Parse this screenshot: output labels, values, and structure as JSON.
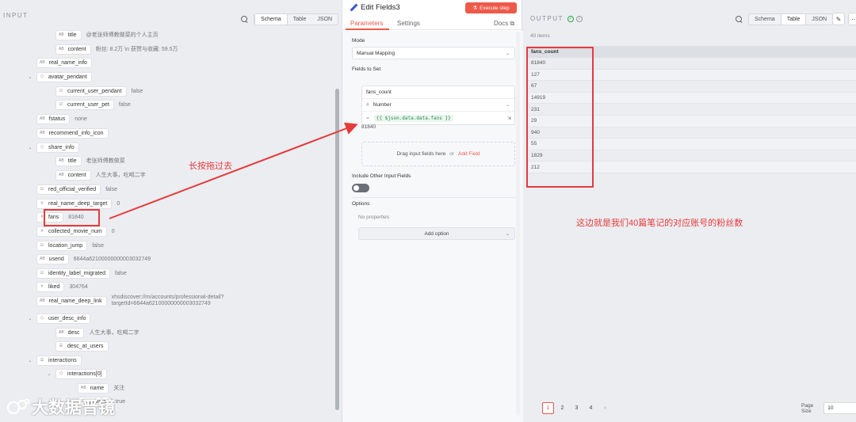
{
  "input_panel": {
    "title": "INPUT",
    "view_modes": [
      "Schema",
      "Table",
      "JSON"
    ],
    "tree": [
      {
        "key": "title",
        "type": "AB",
        "value": "@老张师傅教做菜的个人主页",
        "depth": 2,
        "chevron": ""
      },
      {
        "key": "content",
        "type": "AB",
        "value": "粉丝: 8.2万 \\n 获赞与收藏: 59.5万",
        "depth": 2,
        "chevron": ""
      },
      {
        "key": "real_name_info",
        "type": "AB",
        "value": "",
        "depth": 1,
        "chevron": ""
      },
      {
        "key": "avatar_pendant",
        "type": "⬡",
        "value": "",
        "depth": 1,
        "chevron": "⌄"
      },
      {
        "key": "current_user_pendant",
        "type": "☑",
        "value": "false",
        "depth": 2,
        "chevron": ""
      },
      {
        "key": "current_user_pet",
        "type": "☑",
        "value": "false",
        "depth": 2,
        "chevron": ""
      },
      {
        "key": "fstatus",
        "type": "AB",
        "value": "none",
        "depth": 1,
        "chevron": ""
      },
      {
        "key": "recommend_info_icon",
        "type": "AB",
        "value": "",
        "depth": 1,
        "chevron": ""
      },
      {
        "key": "share_info",
        "type": "⬡",
        "value": "",
        "depth": 1,
        "chevron": "⌄"
      },
      {
        "key": "title",
        "type": "AB",
        "value": "老张师傅教做菜",
        "depth": 2,
        "chevron": ""
      },
      {
        "key": "content",
        "type": "AB",
        "value": "人生大事，吃喝二字",
        "depth": 2,
        "chevron": ""
      },
      {
        "key": "red_official_verified",
        "type": "☑",
        "value": "false",
        "depth": 1,
        "chevron": ""
      },
      {
        "key": "real_name_deep_target",
        "type": "#",
        "value": "0",
        "depth": 1,
        "chevron": ""
      },
      {
        "key": "fans",
        "type": "#",
        "value": "81840",
        "depth": 1,
        "chevron": ""
      },
      {
        "key": "collected_movie_num",
        "type": "#",
        "value": "0",
        "depth": 1,
        "chevron": ""
      },
      {
        "key": "location_jump",
        "type": "☑",
        "value": "false",
        "depth": 1,
        "chevron": ""
      },
      {
        "key": "userid",
        "type": "AB",
        "value": "6644a62100000000003032749",
        "depth": 1,
        "chevron": ""
      },
      {
        "key": "identity_label_migrated",
        "type": "☑",
        "value": "false",
        "depth": 1,
        "chevron": ""
      },
      {
        "key": "liked",
        "type": "#",
        "value": "304764",
        "depth": 1,
        "chevron": ""
      },
      {
        "key": "real_name_deep_link",
        "type": "AB",
        "value": "xhsdiscover://rn/accounts/professional-detail?targetId=6644a62100000000003032749",
        "depth": 1,
        "chevron": ""
      },
      {
        "key": "user_desc_info",
        "type": "⬡",
        "value": "",
        "depth": 1,
        "chevron": "⌄"
      },
      {
        "key": "desc",
        "type": "AB",
        "value": "人生大事，吃喝二字",
        "depth": 2,
        "chevron": ""
      },
      {
        "key": "desc_at_users",
        "type": "☰",
        "value": "",
        "depth": 2,
        "chevron": ""
      },
      {
        "key": "interactions",
        "type": "☰",
        "value": "",
        "depth": 1,
        "chevron": "⌄"
      },
      {
        "key": "interactions[0]",
        "type": "⬡",
        "value": "",
        "depth": 2,
        "chevron": "⌄"
      },
      {
        "key": "name",
        "type": "AB",
        "value": "关注",
        "depth": 3,
        "chevron": ""
      },
      {
        "key": "private",
        "type": "☑",
        "value": "true",
        "depth": 3,
        "chevron": ""
      }
    ]
  },
  "center_panel": {
    "title": "Edit Fields3",
    "execute_label": "Execute step",
    "tabs": [
      "Parameters",
      "Settings"
    ],
    "docs_label": "Docs",
    "mode_label": "Mode",
    "mode_value": "Manual Mapping",
    "fields_to_set_label": "Fields to Set",
    "field_name": "fans_count",
    "field_type": "Number",
    "field_expression": "{{ $json.data.data.fans }}",
    "field_preview": "81840",
    "drop_text": "Drag input fields here",
    "drop_or": "or",
    "add_field_label": "Add Field",
    "include_other_label": "Include Other Input Fields",
    "options_label": "Options",
    "no_properties_text": "No properties",
    "add_option_label": "Add option"
  },
  "output_panel": {
    "title": "OUTPUT",
    "items_count": "40 items",
    "view_modes": [
      "Schema",
      "Table",
      "JSON"
    ],
    "column": "fans_count",
    "rows": [
      "81840",
      "127",
      "67",
      "14919",
      "231",
      "29",
      "940",
      "55",
      "1829",
      "212"
    ],
    "pages": [
      "1",
      "2",
      "3",
      "4"
    ],
    "page_size_label": "Page Size",
    "page_size_value": "10"
  },
  "annotations": {
    "drag_hint": "长按拖过去",
    "output_hint": "这边就是我们40篇笔记的对应账号的粉丝数",
    "watermark": "大数据晋镜"
  },
  "colors": {
    "accent": "#ee5a4a",
    "annotation": "#e53b3b",
    "brand_icon": "#3f58c9",
    "success": "#28a745"
  }
}
